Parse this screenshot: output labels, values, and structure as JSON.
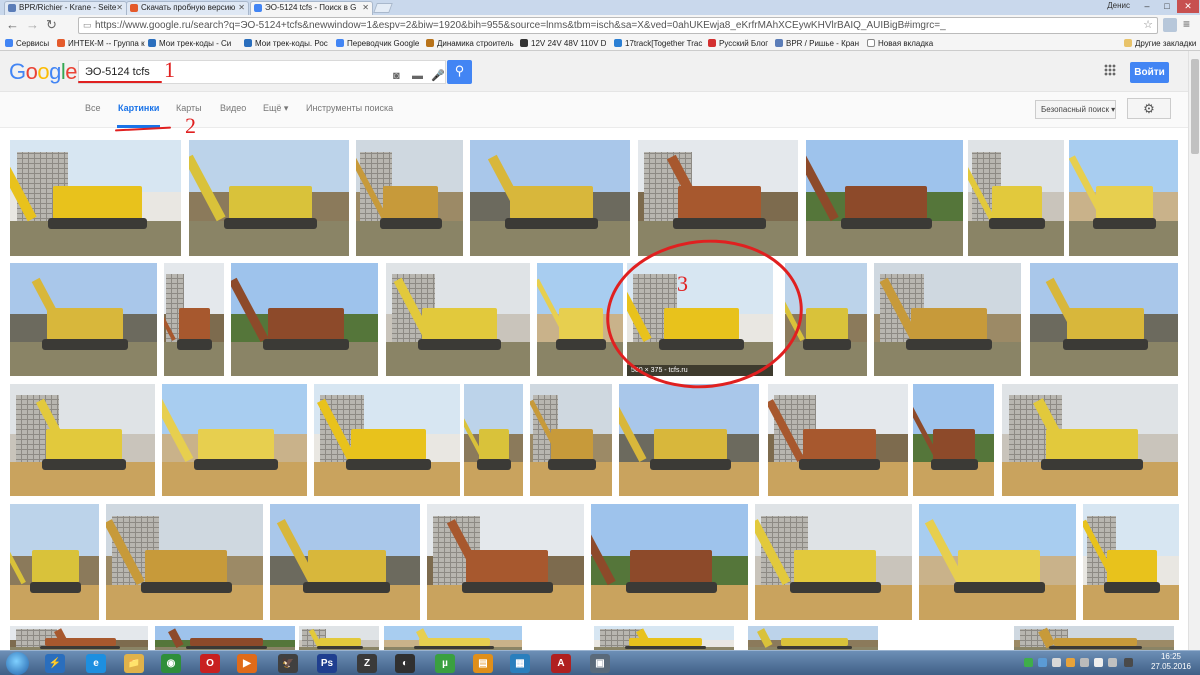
{
  "browser": {
    "tabs": [
      {
        "title": "BPR/Richier - Krane - Seite",
        "active": false,
        "favicon_color": "#5b7db8"
      },
      {
        "title": "Скачать пробную версию",
        "active": false,
        "favicon_color": "#e45a2b"
      },
      {
        "title": "ЭО-5124 tcfs - Поиск в G",
        "active": true,
        "favicon_color": "#4285f4"
      }
    ],
    "user": "Денис",
    "window_buttons": [
      "–",
      "□",
      "✕"
    ],
    "url": "https://www.google.ru/search?q=ЭО-5124+tcfs&newwindow=1&espv=2&biw=1920&bih=955&source=lnms&tbm=isch&sa=X&ved=0ahUKEwja8_eKrfrMAhXCEywKHVlrBAIQ_AUIBigB#imgrc=_",
    "nav_icons": [
      "←",
      "→",
      "↻"
    ],
    "bookmarks": [
      {
        "label": "Сервисы",
        "color": "#4285f4"
      },
      {
        "label": "ИНТЕК-М -- Группа к",
        "color": "#e45a2b"
      },
      {
        "label": "Мои трек-коды - Си",
        "color": "#2a6ebd"
      },
      {
        "label": "Мои трек-коды. Рос",
        "color": "#2a6ebd"
      },
      {
        "label": "Переводчик Google",
        "color": "#4285f4"
      },
      {
        "label": "Динамика строитель",
        "color": "#b8731a"
      },
      {
        "label": "12V 24V 48V 110V D",
        "color": "#333333"
      },
      {
        "label": "17track[Together Trac",
        "color": "#2b7fd4"
      },
      {
        "label": "Русский Блог",
        "color": "#d32f2f"
      },
      {
        "label": "BPR / Ришье - Кран",
        "color": "#5b7db8"
      },
      {
        "label": "Новая вкладка",
        "color": "#ffffff"
      }
    ],
    "other_bookmarks": "Другие закладки"
  },
  "google": {
    "logo": "Google",
    "logo_colors": [
      "#4285f4",
      "#ea4335",
      "#fbbc05",
      "#4285f4",
      "#34a853",
      "#ea4335"
    ],
    "query": "ЭО-5124 tcfs",
    "signin_label": "Войти",
    "nav_tabs": [
      "Все",
      "Картинки",
      "Карты",
      "Видео",
      "Ещё ▾",
      "Инструменты поиска"
    ],
    "active_tab": "Картинки",
    "safesearch_label": "Безопасный поиск ▾",
    "settings_icon": "gear-icon"
  },
  "annotations": {
    "n1": "1",
    "n2": "2",
    "n3": "3",
    "color": "#e02020"
  },
  "highlighted_caption": "500 × 375 - tcfs.ru",
  "taskbar": {
    "apps": [
      "⚡",
      "e",
      "📁",
      "◉",
      "O",
      "▶",
      "🦅",
      "Ps",
      "Z",
      "◐",
      "µ",
      "▤",
      "▦",
      "A",
      "▣"
    ],
    "clock_time": "16:25",
    "clock_date": "27.05.2016"
  }
}
